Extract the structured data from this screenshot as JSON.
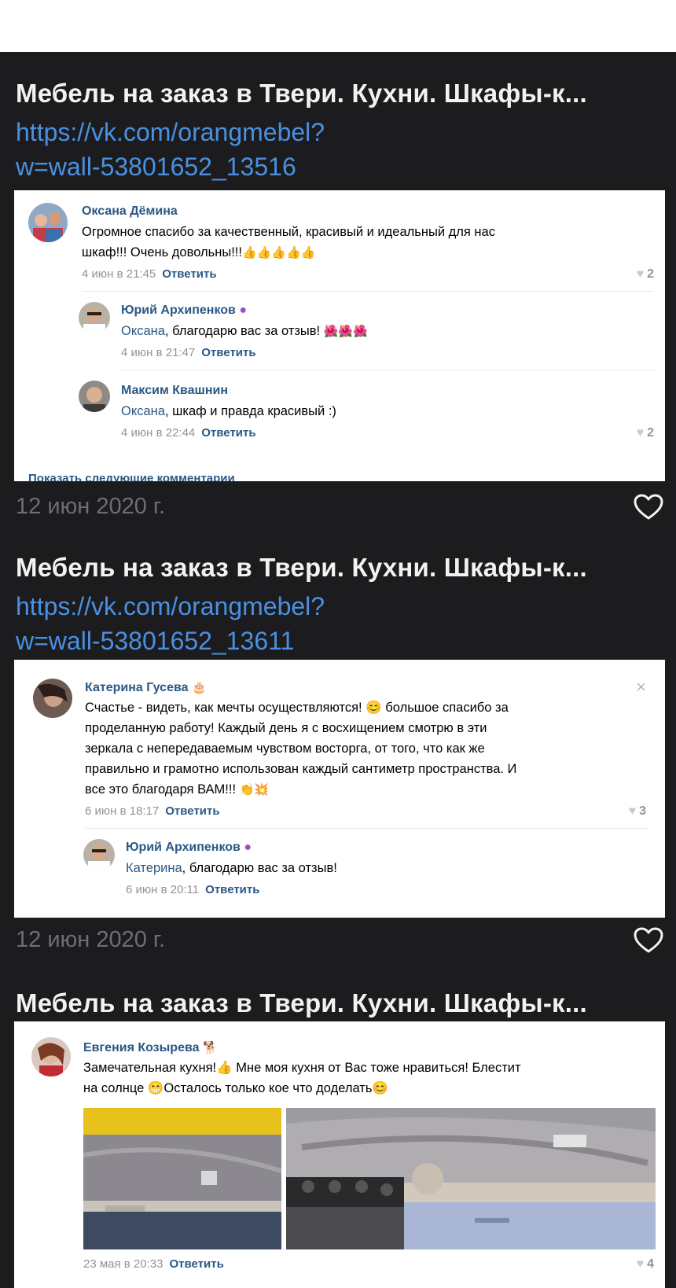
{
  "posts": [
    {
      "title": "Мебель на заказ в Твери. Кухни. Шкафы-к...",
      "link_line1": "https://vk.com/orangmebel?",
      "link_line2": "w=wall-53801652_13516",
      "date": "12 июн 2020 г.",
      "comments": [
        {
          "author": "Оксана Дёмина",
          "text_line1": "Огромное спасибо за качественный, красивый и идеальный для нас",
          "text_line2": "шкаф!!! Очень довольны!!!",
          "emoji": "👍👍👍👍👍",
          "time": "4 июн в 21:45",
          "reply": "Ответить",
          "likes": "2"
        },
        {
          "author": "Юрий Архипенков",
          "mention": "Оксана",
          "text": ", благодарю вас за отзыв!",
          "emoji": "🌺🌺🌺",
          "time": "4 июн в 21:47",
          "reply": "Ответить"
        },
        {
          "author": "Максим Квашнин",
          "mention": "Оксана",
          "text": ", шкаф и правда красивый :)",
          "time": "4 июн в 22:44",
          "reply": "Ответить",
          "likes": "2"
        }
      ],
      "cut_text": "Показать следующие комментарии"
    },
    {
      "title": "Мебель на заказ в Твери. Кухни. Шкафы-к...",
      "link_line1": "https://vk.com/orangmebel?",
      "link_line2": "w=wall-53801652_13611",
      "date": "12 июн 2020 г.",
      "comments": [
        {
          "author": "Катерина Гусева",
          "author_emoji": "🎂",
          "text_line1": "Счастье - видеть, как мечты осуществляются! 😊 большое спасибо за",
          "text_line2": "проделанную работу! Каждый день я с восхищением смотрю в эти",
          "text_line3": "зеркала с непередаваемым чувством восторга, от того, что как же",
          "text_line4": "правильно и грамотно использован каждый сантиметр пространства. И",
          "text_line5": "все это благодаря ВАМ!!!",
          "emoji": "👏💥",
          "time": "6 июн в 18:17",
          "reply": "Ответить",
          "likes": "3",
          "close": "×"
        },
        {
          "author": "Юрий Архипенков",
          "mention": "Катерина",
          "text": ", благодарю вас за отзыв!",
          "time": "6 июн в 20:11",
          "reply": "Ответить"
        }
      ]
    },
    {
      "title": "Мебель на заказ в Твери. Кухни. Шкафы-к...",
      "comments": [
        {
          "author": "Евгения Козырева",
          "author_emoji": "🐕",
          "text_line1": "Замечательная кухня!👍 Мне моя кухня от Вас тоже нравиться! Блестит",
          "text_line2": "на солнце 😁Осталось только кое что доделать😊",
          "time": "23 мая в 20:33",
          "reply": "Ответить",
          "likes": "4"
        }
      ]
    }
  ],
  "colors": {
    "background": "#1c1c1e",
    "title": "#f2f2f2",
    "link": "#4a90e2",
    "date": "#6e6e73",
    "vk_name": "#2a5885"
  },
  "icons": [
    "heart-outline-icon",
    "heart-like-icon",
    "purple-ball-icon",
    "close-icon"
  ]
}
